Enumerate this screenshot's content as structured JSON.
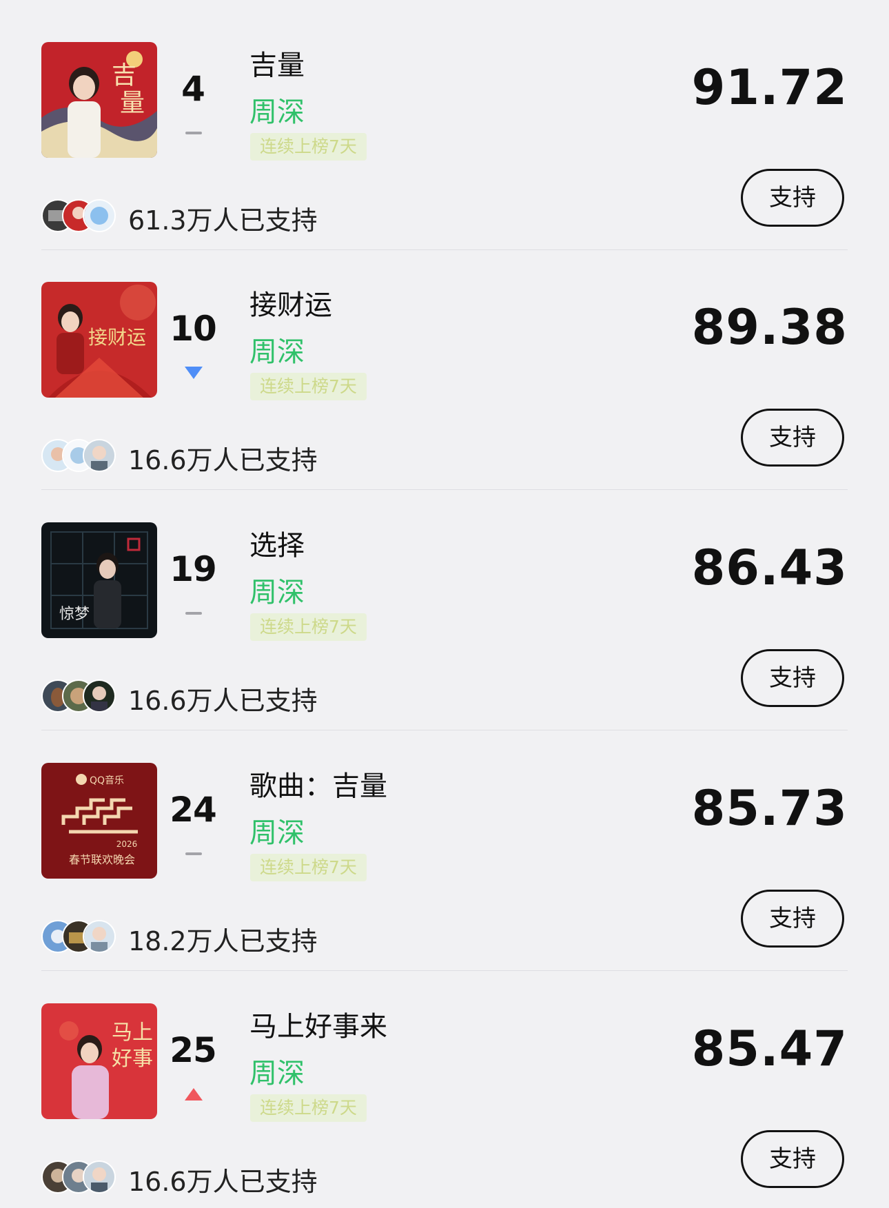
{
  "items": [
    {
      "rank": "4",
      "trend": "same",
      "title": "吉量",
      "artist": "周深",
      "streak": "连续上榜7天",
      "score": "91.72",
      "supporters": "61.3万人已支持",
      "button": "支持",
      "cover_colors": [
        "#c2232a",
        "#e8d9b0",
        "#2d6a8a"
      ]
    },
    {
      "rank": "10",
      "trend": "down",
      "title": "接财运",
      "artist": "周深",
      "streak": "连续上榜7天",
      "score": "89.38",
      "supporters": "16.6万人已支持",
      "button": "支持",
      "cover_colors": [
        "#c62a2a",
        "#e35a48",
        "#f2d58a"
      ]
    },
    {
      "rank": "19",
      "trend": "same",
      "title": "选择",
      "artist": "周深",
      "streak": "连续上榜7天",
      "score": "86.43",
      "supporters": "16.6万人已支持",
      "button": "支持",
      "cover_colors": [
        "#0f1418",
        "#2a3a44",
        "#c02a3a"
      ]
    },
    {
      "rank": "24",
      "trend": "same",
      "title": "歌曲：吉量",
      "artist": "周深",
      "streak": "连续上榜7天",
      "score": "85.73",
      "supporters": "18.2万人已支持",
      "button": "支持",
      "cover_colors": [
        "#7e1416",
        "#f4d7b0",
        "#ffffff"
      ],
      "cover_texts": [
        "QQ音乐",
        "2026",
        "春节联欢晚会"
      ]
    },
    {
      "rank": "25",
      "trend": "up",
      "title": "马上好事来",
      "artist": "周深",
      "streak": "连续上榜7天",
      "score": "85.47",
      "supporters": "16.6万人已支持",
      "button": "支持",
      "cover_colors": [
        "#d8343a",
        "#e7b9d8",
        "#f6e1a8"
      ]
    }
  ],
  "colors": {
    "artist": "#30c16a",
    "streak_bg": "#e9f1da",
    "streak_text": "#cdd98a",
    "trend_down": "#4f8ef7",
    "trend_up": "#f0575c",
    "trend_same": "#a3a3a8"
  },
  "icons": {
    "trend_same": "dash-icon",
    "trend_down": "triangle-down-icon",
    "trend_up": "triangle-up-icon"
  }
}
